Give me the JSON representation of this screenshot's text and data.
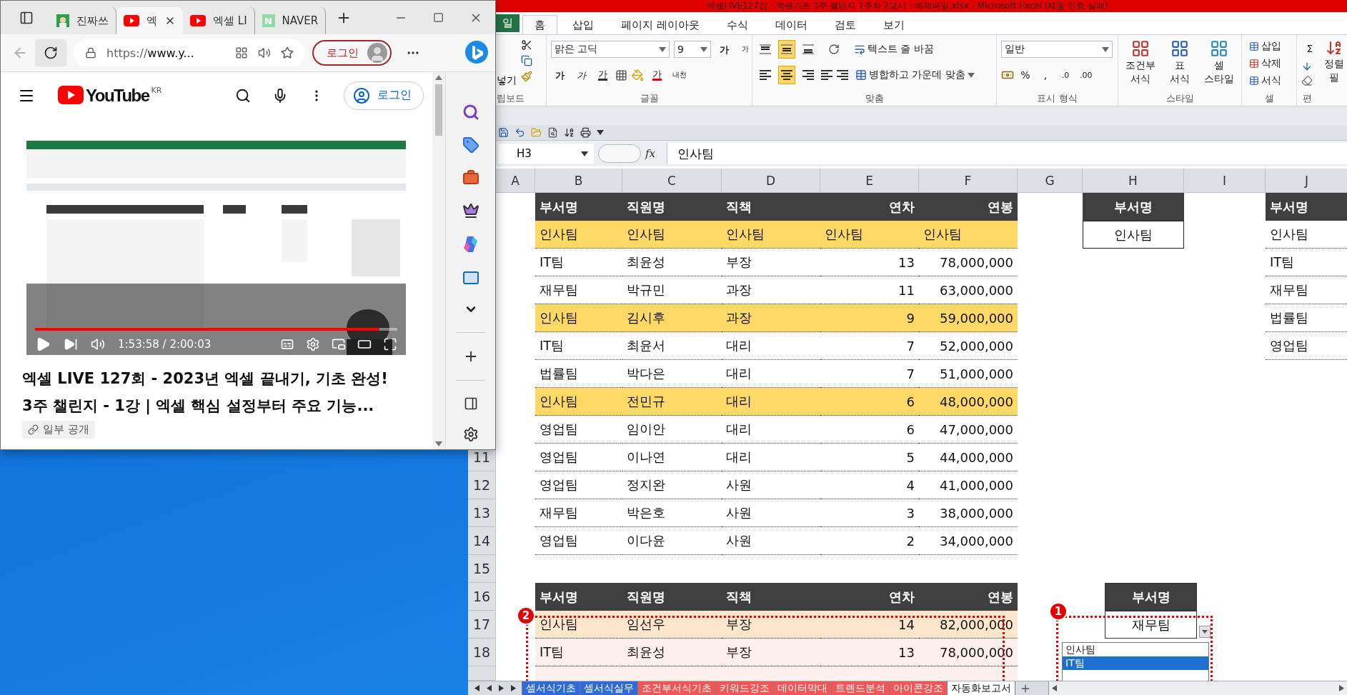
{
  "browser": {
    "tabs": [
      {
        "label": "진짜쓰",
        "selected": false
      },
      {
        "kind": "youtube",
        "label": "엑",
        "selected": true
      },
      {
        "kind": "youtube",
        "label": "엑셀 LI",
        "selected": false
      },
      {
        "kind": "naver",
        "label": "NAVER",
        "badge": "N",
        "selected": false
      }
    ],
    "url": {
      "scheme": "https://",
      "host": "www.y..."
    },
    "profile_button": "로그인",
    "youtube": {
      "logo": "YouTube",
      "region": "KR",
      "login": "로그인",
      "video": {
        "time": "1:53:58 / 2:00:03",
        "level": 0.95
      },
      "title_lines": [
        "엑셀 LIVE 127회 - 2023년 엑셀 끝내기, 기초 완성!",
        "3주 챌린지 - 1강 | 엑셀 핵심 설정부터 주요 기능..."
      ],
      "visibility": "일부 공개"
    }
  },
  "excel": {
    "title": "엑셀LIVE127강 - 엑셀기초 3주 챌린지 1주차 2교시 - 예제파일.xlsx - Microsoft Excel (제품 인증 실패)",
    "ribbon_tabs": [
      {
        "kind": "file",
        "label": "일",
        "selected": false
      },
      {
        "kind": "tab",
        "label": "홈",
        "selected": true
      },
      {
        "kind": "tab",
        "label": "삽입",
        "selected": false
      },
      {
        "kind": "tab",
        "label": "페이지 레이아웃",
        "selected": false
      },
      {
        "kind": "tab",
        "label": "수식",
        "selected": false
      },
      {
        "kind": "tab",
        "label": "데이터",
        "selected": false
      },
      {
        "kind": "tab",
        "label": "검토",
        "selected": false
      },
      {
        "kind": "tab",
        "label": "보기",
        "selected": false
      }
    ],
    "ribbon": {
      "groups": [
        "립보드",
        "글꼴",
        "맞춤",
        "표시 형식",
        "스타일",
        "셀",
        "편"
      ],
      "paste": "넣기",
      "font_name": "맑은 고딕",
      "font_size": "9",
      "font_glyphs": [
        "가",
        "가",
        "가",
        "가",
        "가",
        "가"
      ],
      "phonetic": "내천",
      "vertical_align": [
        {
          "selected": false
        },
        {
          "selected": true
        },
        {
          "selected": false
        }
      ],
      "horizontal_align": [
        {
          "selected": false
        },
        {
          "selected": true
        },
        {
          "selected": false
        }
      ],
      "wrap_text": "텍스트 줄 바꿈",
      "merge": "병합하고 가운데 맞춤",
      "number_format": "일반",
      "number_symbols": [
        "%",
        ","
      ],
      "decimals": [
        ".0",
        ".00"
      ],
      "style_buttons": [
        [
          "조건부",
          "서식"
        ],
        [
          "표",
          "서식"
        ],
        [
          "셀",
          "스타일"
        ]
      ],
      "cell_buttons": [
        "삽입",
        "삭제",
        "서식"
      ],
      "sum": "Σ",
      "sort_lines": [
        "정렬",
        "필"
      ]
    },
    "name_box": "H3",
    "fx": "fx",
    "formula": "인사팀",
    "columns": [
      "A",
      "B",
      "C",
      "D",
      "E",
      "F",
      "G",
      "H",
      "I",
      "J"
    ],
    "row_numbers": [
      "11",
      "12",
      "13",
      "14",
      "15",
      "16",
      "17",
      "18"
    ],
    "table": {
      "header": [
        "부서명",
        "직원명",
        "직책",
        "연차",
        "연봉"
      ],
      "rows": [
        {
          "kind": "text",
          "highlighted": true,
          "cells": [
            "인사팀",
            "인사팀",
            "인사팀",
            "인사팀",
            "인사팀"
          ]
        },
        {
          "kind": "record",
          "highlighted": false,
          "cells": [
            "IT팀",
            "최윤성",
            "부장",
            "13",
            "78,000,000"
          ]
        },
        {
          "kind": "record",
          "highlighted": false,
          "cells": [
            "재무팀",
            "박규민",
            "과장",
            "11",
            "63,000,000"
          ]
        },
        {
          "kind": "record",
          "highlighted": true,
          "cells": [
            "인사팀",
            "김시후",
            "과장",
            "9",
            "59,000,000"
          ]
        },
        {
          "kind": "record",
          "highlighted": false,
          "cells": [
            "IT팀",
            "최윤서",
            "대리",
            "7",
            "52,000,000"
          ]
        },
        {
          "kind": "record",
          "highlighted": false,
          "cells": [
            "법률팀",
            "박다은",
            "대리",
            "7",
            "51,000,000"
          ]
        },
        {
          "kind": "record",
          "highlighted": true,
          "cells": [
            "인사팀",
            "전민규",
            "대리",
            "6",
            "48,000,000"
          ]
        },
        {
          "kind": "record",
          "highlighted": false,
          "cells": [
            "영업팀",
            "임이안",
            "대리",
            "6",
            "47,000,000"
          ]
        },
        {
          "kind": "record",
          "highlighted": false,
          "cells": [
            "영업팀",
            "이나연",
            "대리",
            "5",
            "44,000,000"
          ]
        },
        {
          "kind": "record",
          "highlighted": false,
          "cells": [
            "영업팀",
            "정지완",
            "사원",
            "4",
            "41,000,000"
          ]
        },
        {
          "kind": "record",
          "highlighted": false,
          "cells": [
            "재무팀",
            "박은호",
            "사원",
            "3",
            "38,000,000"
          ]
        },
        {
          "kind": "record",
          "highlighted": false,
          "cells": [
            "영업팀",
            "이다윤",
            "사원",
            "2",
            "34,000,000"
          ]
        }
      ]
    },
    "filter": {
      "header": "부서명",
      "value": "인사팀"
    },
    "dept_list": {
      "header": "부서명",
      "items": [
        "인사팀",
        "IT팀",
        "재무팀",
        "법률팀",
        "영업팀"
      ]
    },
    "report": {
      "header": [
        "부서명",
        "직원명",
        "직책",
        "연차",
        "연봉"
      ],
      "rows": [
        {
          "highlighted": true,
          "cells": [
            "인사팀",
            "임선우",
            "부장",
            "14",
            "82,000,000"
          ]
        },
        {
          "highlighted": false,
          "cells": [
            "IT팀",
            "최윤성",
            "부장",
            "13",
            "78,000,000"
          ]
        }
      ]
    },
    "report_filter": {
      "header": "부서명",
      "value": "재무팀",
      "options": [
        {
          "label": "인사팀",
          "selected": false
        },
        {
          "label": "IT팀",
          "selected": true
        }
      ]
    },
    "callouts": [
      "1",
      "2"
    ],
    "sheet_tabs": [
      {
        "label": "셀서식기초",
        "color": "#2f6bd8",
        "selected": false
      },
      {
        "label": "셀서식실무",
        "color": "#2f6bd8",
        "selected": false
      },
      {
        "label": "조건부서식기초",
        "color": "#f25555",
        "selected": false
      },
      {
        "label": "키워드강조",
        "color": "#f25555",
        "selected": false
      },
      {
        "label": "데이터막대",
        "color": "#f25555",
        "selected": false
      },
      {
        "label": "트렌드분석",
        "color": "#f25555",
        "selected": false
      },
      {
        "label": "아이콘강조",
        "color": "#f25555",
        "selected": false
      },
      {
        "label": "자동화보고서",
        "color": "#ffffff",
        "selected": true
      }
    ]
  }
}
